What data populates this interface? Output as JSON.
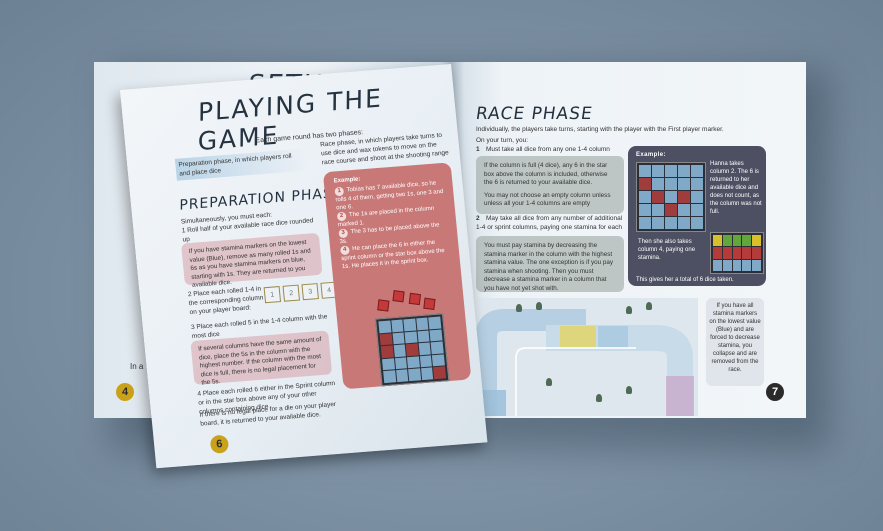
{
  "left_back_page": {
    "title": "SETUP",
    "peek_text": "In a",
    "page_number": "4"
  },
  "front_page": {
    "title": "PLAYING THE GAME",
    "intro": "Each game round has two phases:",
    "prep_summary": "Preparation phase, in which players roll and place dice",
    "race_summary": "Race phase, in which players take turns to use dice and wax tokens to move on the race course and shoot at the shooting range",
    "prep_heading": "PREPARATION PHASE",
    "simultaneously": "Simultaneously, you must each:",
    "step1": "1  Roll half of your available race dice rounded up",
    "stamina_note": "If you have stamina markers on the lowest value (Blue), remove as many rolled 1s and 6s as you have stamina markers on blue, starting with 1s. They are returned to you available dice.",
    "step2": "2  Place each rolled 1-4 in the corresponding column on your player board:",
    "step3": "3  Place each rolled 5 in the 1-4 column with the most dice",
    "tie_note": "If several columns have the same amount of dice, place the 5s in the column with the highest number. If the column with the most dice is full, there is no legal placement for the 5s.",
    "step4": "4  Place each rolled 6 either in the Sprint column or in the star box above any of your other columns containing dice",
    "step4_note": "If there is no legal place for a die on your player board, it is returned to your available dice.",
    "dice_faces": [
      "1",
      "2",
      "3",
      "4"
    ],
    "example": {
      "label": "Example:",
      "lines": [
        "Tobias has 7 available dice, so he rolls 4 of them, getting two 1s, one 3 and one 6.",
        "The 1s are placed in the column marked 1.",
        "The 3 has to be placed above the 3s.",
        "He can place the 6 in either the sprint column or the star box above the 1s. He places it in the sprint box."
      ]
    },
    "page_number": "6"
  },
  "right_page": {
    "title": "RACE PHASE",
    "intro": "Individually, the players take turns, starting with the player with the First player marker.",
    "on_turn": "On your turn, you:",
    "step1": "Must take all dice from any one 1-4 column",
    "step1_note_a": "If the column is full (4 dice), any 6 in the star box above the column is included, otherwise the 6 is returned to your available dice.",
    "step1_note_b": "You may not choose an empty column unless unless all your 1-4 columns are empty",
    "step2": "May take all dice from any number of additional 1-4 or sprint columns, paying one stamina for each",
    "step2_note": "You must pay stamina by decreasing the stamina marker in the column with the highest stamina value. The one exception is if you pay stamina when shooting. Then you must decrease a stamina marker in a column that you have not yet shot with.",
    "example": {
      "label": "Example:",
      "text1": "Hanna takes column 2. The 6 is returned to her available dice and does not count, as the column was not full.",
      "text2": "Then she also takes column 4, paying one stamina.",
      "text3": "This gives her a total of 6 dice taken."
    },
    "stamina_side": "If you have all stamina markers on the lowest value (Blue) and are forced to decrease stamina, you collapse and are removed from the race.",
    "page_number": "7"
  },
  "colors": {
    "background": "#7b8fa2",
    "pink_box": "#d6a0a5",
    "example_red": "#c97878",
    "example_dark": "#4c5062",
    "gold_badge": "#c9a21a"
  }
}
